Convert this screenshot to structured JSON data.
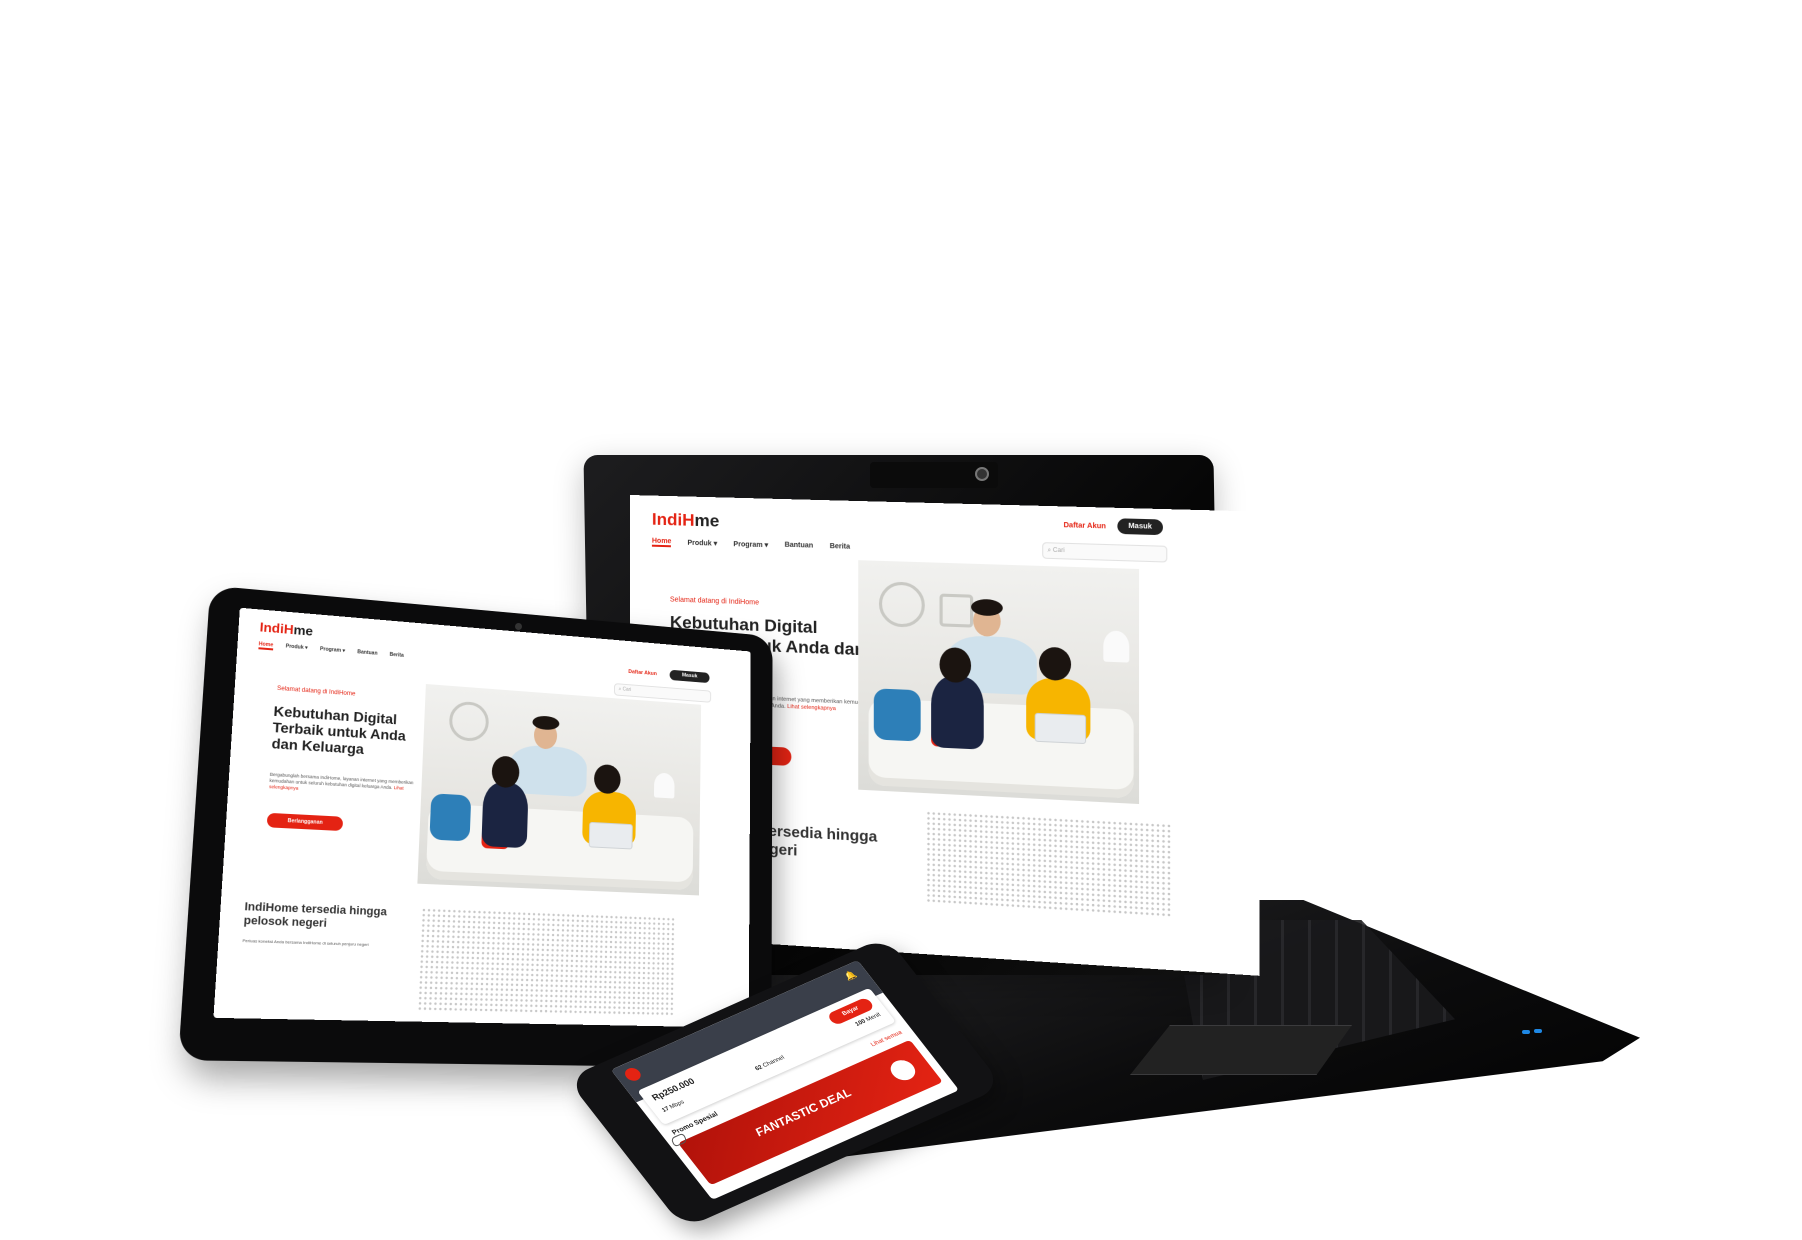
{
  "site": {
    "logo_part1": "IndiH",
    "logo_part2": "me",
    "nav": [
      "Home",
      "Produk",
      "Program",
      "Bantuan",
      "Berita"
    ],
    "register_label": "Daftar Akun",
    "login_label": "Masuk",
    "search_placeholder": "Cari",
    "welcome": "Selamat datang di IndiHome",
    "headline": "Kebutuhan Digital Terbaik untuk Anda dan Keluarga",
    "body_text": "Bergabunglah bersama IndiHome, layanan internet yang memberikan kemudahan untuk seluruh kebutuhan digital keluarga Anda.",
    "body_link": "Lihat selengkapnya",
    "cta_label": "Berlangganan",
    "coverage_title": "IndiHome tersedia hingga pelosok negeri",
    "coverage_text": "Perluas koneksi Anda bersama IndiHome di seluruh penjuru negeri"
  },
  "app": {
    "balance": "Rp250.000",
    "pay_label": "Bayar",
    "stats": [
      {
        "value": "17",
        "unit": "Mbps"
      },
      {
        "value": "62",
        "unit": "Channel"
      },
      {
        "value": "100",
        "unit": "Menit"
      }
    ],
    "promo_heading": "Promo Spesial",
    "promo_see_all": "Lihat semua",
    "promo_banner": "FANTASTIC DEAL"
  },
  "colors": {
    "brand_red": "#e42313",
    "dark": "#222222"
  }
}
